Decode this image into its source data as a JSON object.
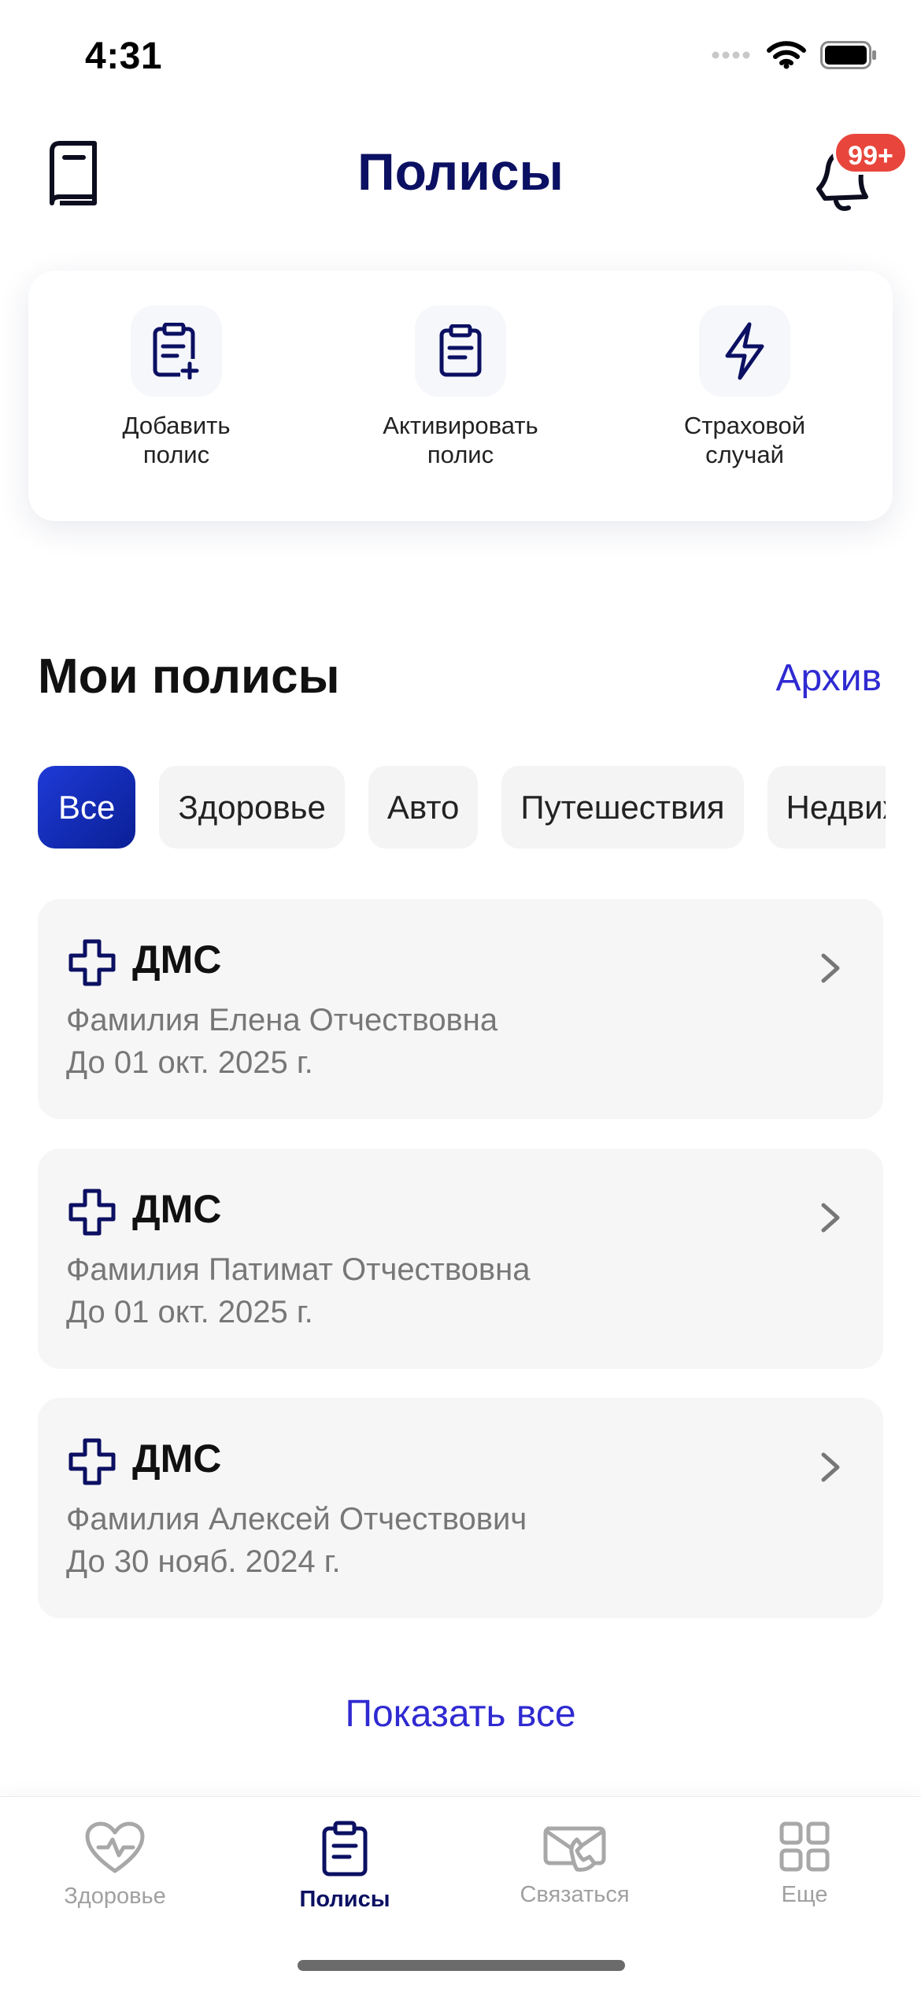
{
  "status_bar": {
    "time": "4:31"
  },
  "header": {
    "title": "Полисы",
    "badge": "99+",
    "left_icon": "book-icon",
    "right_icon": "bell-icon"
  },
  "quick_actions": [
    {
      "label": "Добавить полис",
      "icon": "clipboard-plus-icon"
    },
    {
      "label": "Активировать полис",
      "icon": "clipboard-list-icon"
    },
    {
      "label": "Страховой случай",
      "icon": "lightning-icon"
    }
  ],
  "section": {
    "title": "Мои полисы",
    "archive_label": "Архив"
  },
  "filters": {
    "selected": "Все",
    "items": [
      "Все",
      "Здоровье",
      "Авто",
      "Путешествия",
      "Недвиж"
    ]
  },
  "policies": [
    {
      "title": "ДМС",
      "name": "Фамилия Елена Отчествовна",
      "valid_until": "До 01 окт. 2025 г.",
      "icon": "medical-cross-icon"
    },
    {
      "title": "ДМС",
      "name": "Фамилия Патимат Отчествовна",
      "valid_until": "До 01 окт. 2025 г.",
      "icon": "medical-cross-icon"
    },
    {
      "title": "ДМС",
      "name": "Фамилия Алексей Отчествович",
      "valid_until": "До 30 нояб. 2024 г.",
      "icon": "medical-cross-icon"
    }
  ],
  "show_all_label": "Показать все",
  "tabbar": {
    "items": [
      {
        "label": "Здоровье",
        "icon": "heart-pulse-icon"
      },
      {
        "label": "Полисы",
        "icon": "clipboard-icon"
      },
      {
        "label": "Связаться",
        "icon": "phone-mail-icon"
      },
      {
        "label": "Еще",
        "icon": "grid-icon"
      }
    ],
    "active": "Полисы"
  },
  "colors": {
    "brand_navy": "#0b1062",
    "accent_link": "#2f2ad1",
    "badge_red": "#e8463c",
    "chip_active": "#1e3ad6"
  }
}
